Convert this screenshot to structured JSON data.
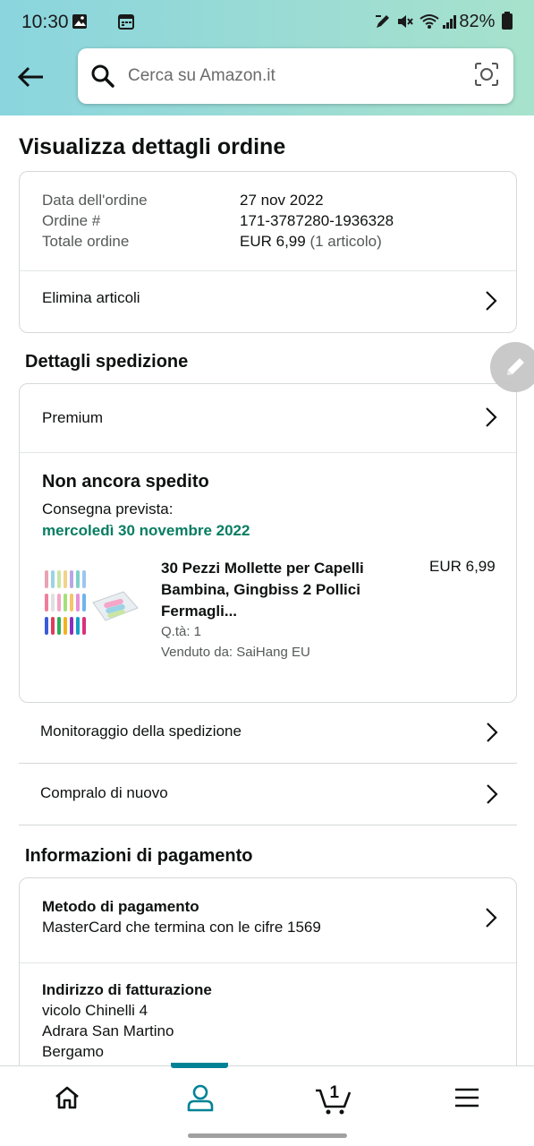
{
  "status_bar": {
    "time": "10:30",
    "battery": "82%",
    "icons": [
      "gallery-icon",
      "calendar-icon",
      "pen-icon",
      "mute-icon",
      "wifi-icon",
      "signal-icon",
      "battery-icon"
    ]
  },
  "search": {
    "placeholder": "Cerca su Amazon.it"
  },
  "page": {
    "title": "Visualizza dettagli ordine"
  },
  "order_summary": {
    "rows": [
      {
        "label": "Data dell'ordine",
        "value": "27 nov 2022"
      },
      {
        "label": "Ordine #",
        "value": "171-3787280-1936328"
      },
      {
        "label": "Totale ordine",
        "value": "EUR 6,99",
        "extra": "(1 articolo)"
      }
    ],
    "delete_items": "Elimina articoli"
  },
  "shipping": {
    "section_title": "Dettagli spedizione",
    "shipping_type": "Premium",
    "status": "Non ancora spedito",
    "expected_label": "Consegna prevista:",
    "expected_date": "mercoledì 30 novembre 2022",
    "product": {
      "title": "30 Pezzi Mollette per Capelli Bambina, Gingbiss 2 Pollici Fermagli...",
      "price": "EUR 6,99",
      "quantity": "Q.tà: 1",
      "seller": "Venduto da: SaiHang EU"
    },
    "track": "Monitoraggio della spedizione",
    "buy_again": "Compralo di nuovo"
  },
  "payment": {
    "section_title": "Informazioni di pagamento",
    "method_title": "Metodo di pagamento",
    "method_value": "MasterCard che termina con le cifre 1569",
    "billing_title": "Indirizzo di fatturazione",
    "billing_lines": [
      "vicolo Chinelli 4",
      "Adrara San Martino",
      "Bergamo"
    ]
  },
  "bottom_nav": {
    "items": [
      "home-icon",
      "account-icon",
      "cart-icon",
      "menu-icon"
    ],
    "cart_count": "1",
    "active": "account-icon",
    "accent_color": "#008296"
  },
  "colors": {
    "header_gradient_start": "#8ad5de",
    "header_gradient_end": "#a7e2cc",
    "delivery_green": "#067d62"
  }
}
